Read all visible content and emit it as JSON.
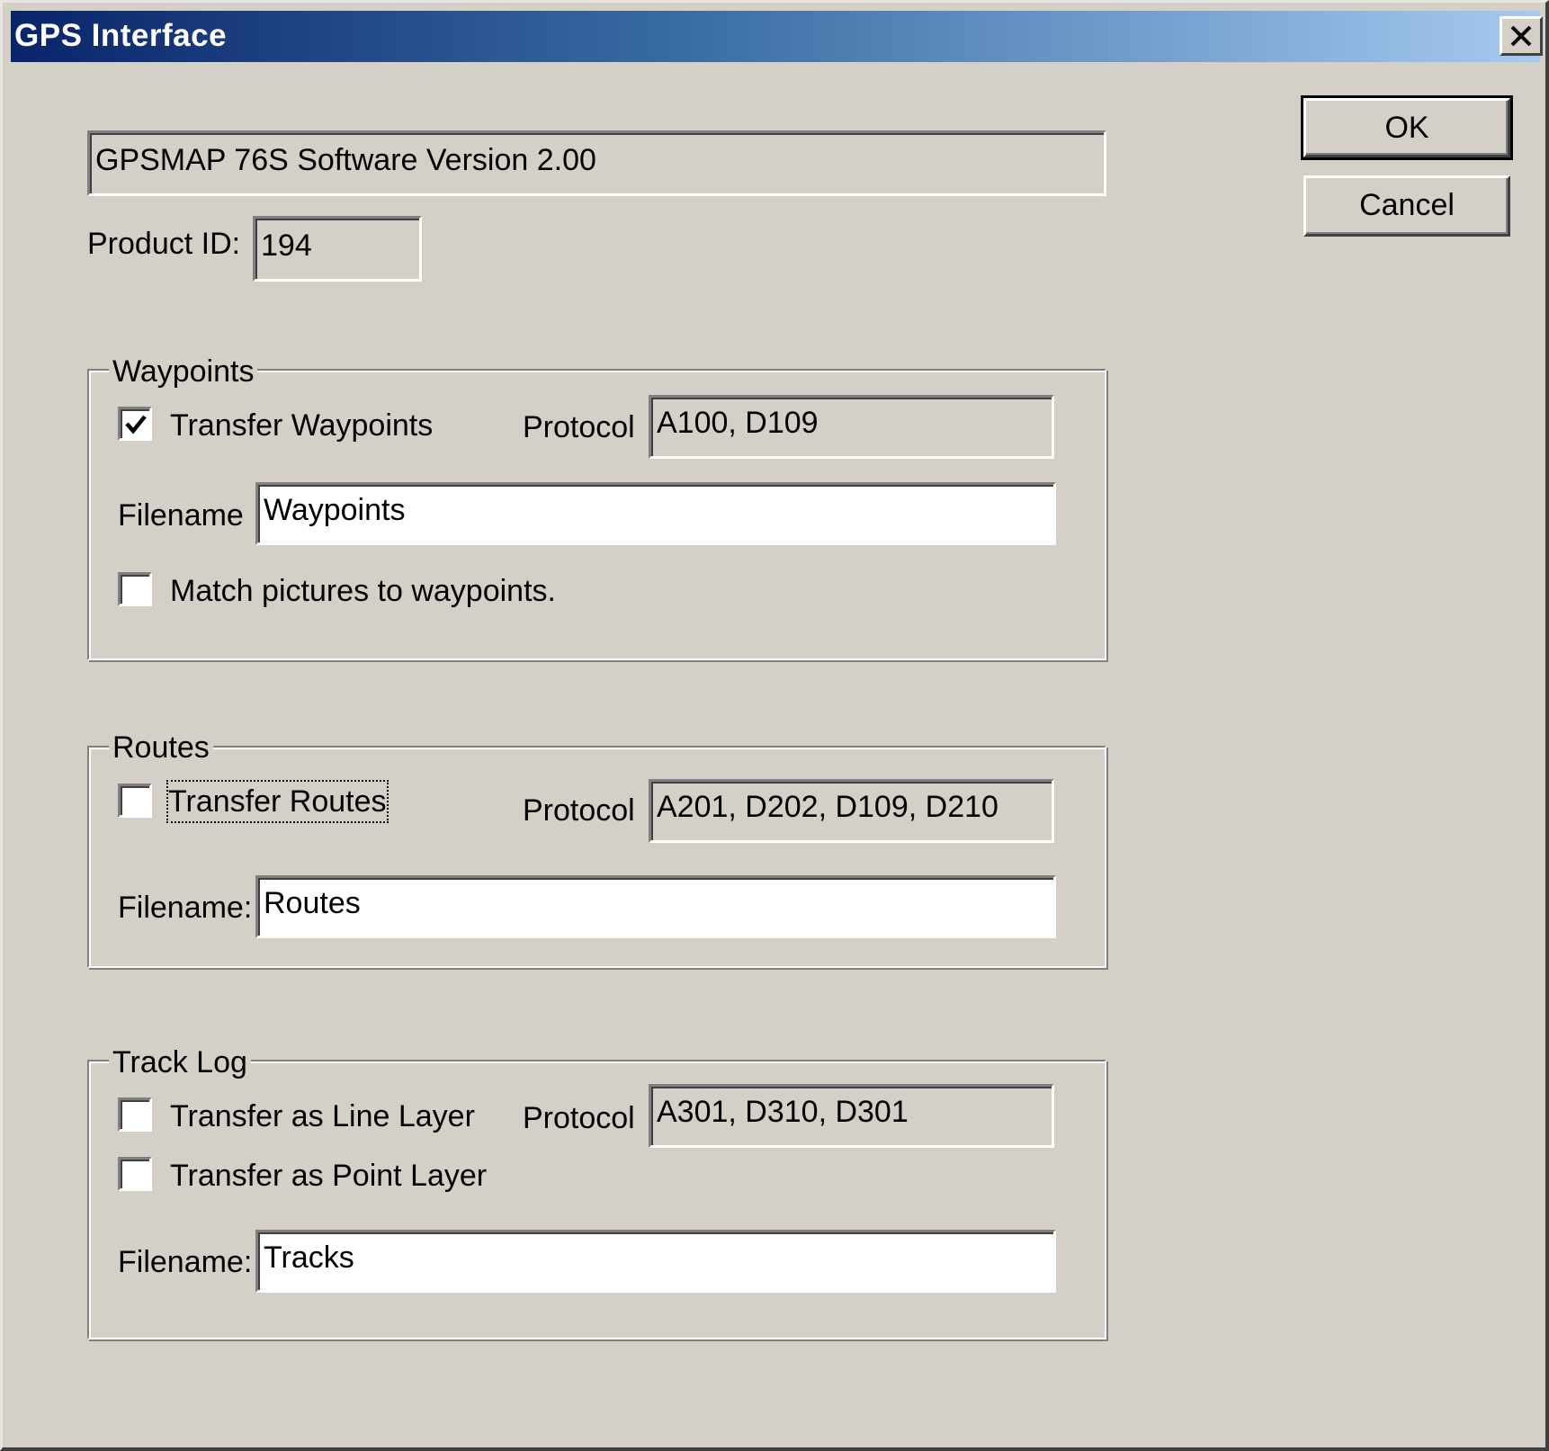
{
  "window": {
    "title": "GPS Interface"
  },
  "device": {
    "description": "GPSMAP 76S Software Version 2.00",
    "product_id_label": "Product ID:",
    "product_id": "194"
  },
  "buttons": {
    "ok": "OK",
    "cancel": "Cancel"
  },
  "waypoints": {
    "group_label": "Waypoints",
    "transfer_label": "Transfer Waypoints",
    "transfer_checked": true,
    "protocol_label": "Protocol",
    "protocol": "A100, D109",
    "filename_label": "Filename",
    "filename": "Waypoints",
    "match_pictures_label": "Match pictures to waypoints.",
    "match_pictures_checked": false
  },
  "routes": {
    "group_label": "Routes",
    "transfer_label": "Transfer Routes",
    "transfer_checked": false,
    "protocol_label": "Protocol",
    "protocol": "A201, D202, D109, D210",
    "filename_label": "Filename:",
    "filename": "Routes"
  },
  "tracklog": {
    "group_label": "Track Log",
    "line_layer_label": "Transfer as Line Layer",
    "line_layer_checked": false,
    "point_layer_label": "Transfer as Point Layer",
    "point_layer_checked": false,
    "protocol_label": "Protocol",
    "protocol": "A301, D310, D301",
    "filename_label": "Filename:",
    "filename": "Tracks"
  }
}
